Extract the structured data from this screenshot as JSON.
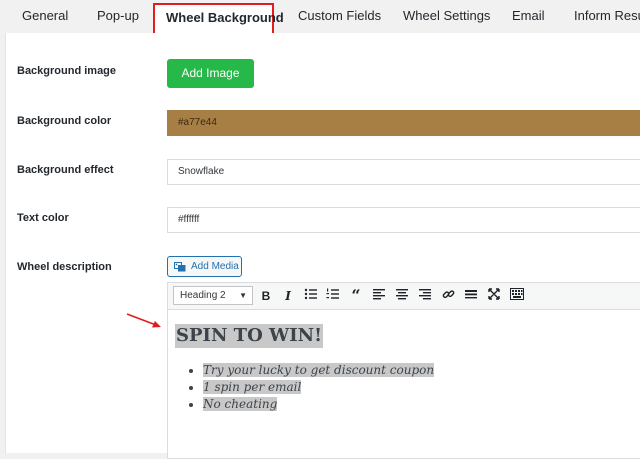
{
  "tabs": [
    "General",
    "Pop-up",
    "Wheel Background",
    "Custom Fields",
    "Wheel Settings",
    "Email",
    "Inform Result"
  ],
  "form": {
    "background_image_label": "Background image",
    "add_image_button": "Add Image",
    "background_color_label": "Background color",
    "background_color_value": "#a77e44",
    "background_effect_label": "Background effect",
    "background_effect_value": "Snowflake",
    "text_color_label": "Text color",
    "text_color_value": "#ffffff",
    "wheel_description_label": "Wheel description",
    "add_media_button": "Add Media"
  },
  "toolbar": {
    "format_select": "Heading 2",
    "icons": [
      "bold-icon",
      "italic-icon",
      "bullet-list-icon",
      "numbered-list-icon",
      "blockquote-icon",
      "align-left-icon",
      "align-center-icon",
      "align-right-icon",
      "link-icon",
      "horizontal-rule-icon",
      "fullscreen-icon",
      "toolbar-toggle-icon"
    ]
  },
  "editor": {
    "heading": "SPIN TO WIN!",
    "bullets": [
      "Try your lucky to get discount coupon",
      "1 spin per email",
      "No cheating"
    ]
  },
  "colors": {
    "swatch": "#a77e44",
    "add_image_bg": "#27b84a",
    "highlight": "#e01e1e"
  }
}
